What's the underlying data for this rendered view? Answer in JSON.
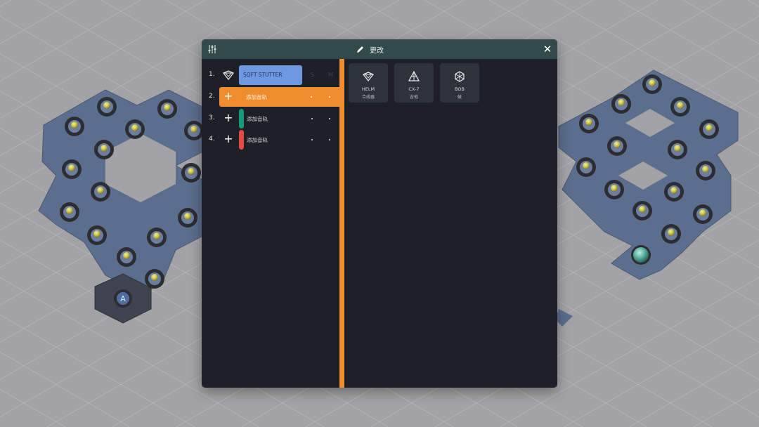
{
  "dialog": {
    "title": "更改",
    "close_label": "✕"
  },
  "tracks": [
    {
      "number": "1.",
      "label": "SOFT STUTTER",
      "solo": "S",
      "mute": "M",
      "color": "#6e98e0"
    },
    {
      "number": "2.",
      "label": "添加音轨",
      "color": "#ef8c2d"
    },
    {
      "number": "3.",
      "label": "添加音轨",
      "color": "#159a7c"
    },
    {
      "number": "4.",
      "label": "添加音轨",
      "color": "#e54b45"
    }
  ],
  "instruments": [
    {
      "name": "HELM",
      "sub": "合成器",
      "icon": "helm-icon"
    },
    {
      "name": "CX-7",
      "sub": "吉他",
      "icon": "cx7-icon"
    },
    {
      "name": "BOB",
      "sub": "鼓",
      "icon": "bob-icon"
    }
  ],
  "colors": {
    "titlebar": "#334a4a",
    "accent": "#ef8c2d",
    "panel": "#1d2027",
    "tile": "#5b6e8e"
  }
}
